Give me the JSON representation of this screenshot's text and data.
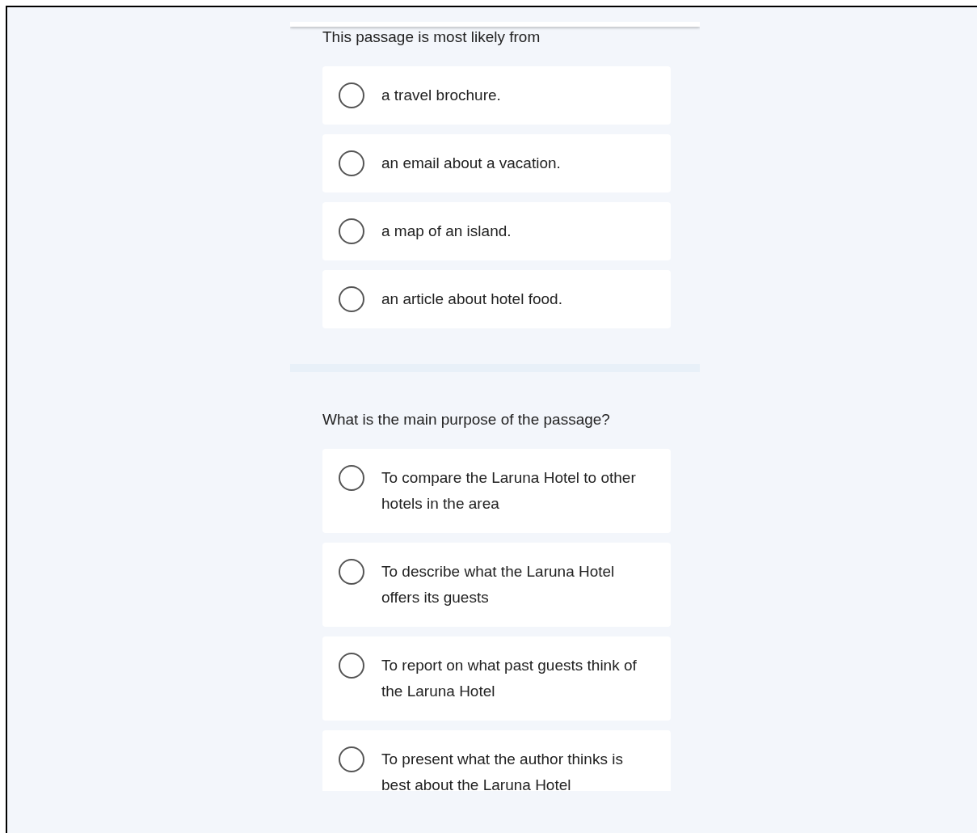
{
  "questions": [
    {
      "prompt": "This passage is most likely from",
      "options": [
        {
          "text": "a travel brochure.",
          "selected": false
        },
        {
          "text": "an email about a vacation.",
          "selected": false
        },
        {
          "text": "a map of an island.",
          "selected": false
        },
        {
          "text": "an article about hotel food.",
          "selected": false
        }
      ]
    },
    {
      "prompt": "What is the main purpose of the passage?",
      "options": [
        {
          "text": "To compare the Laruna Hotel to other hotels in the area",
          "selected": false
        },
        {
          "text": "To describe what the Laruna Hotel offers its guests",
          "selected": false
        },
        {
          "text": "To report on what past guests think of the Laruna Hotel",
          "selected": false
        },
        {
          "text": "To present what the author thinks is best about the Laruna Hotel",
          "selected": false
        }
      ]
    }
  ]
}
